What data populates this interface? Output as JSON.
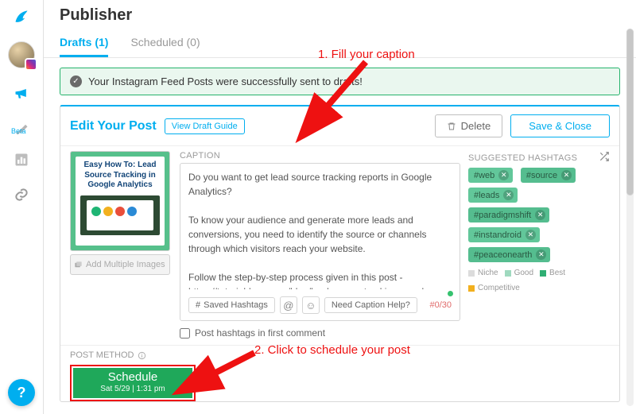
{
  "page": {
    "title": "Publisher"
  },
  "tabs": {
    "drafts": "Drafts (1)",
    "scheduled": "Scheduled (0)"
  },
  "alert": {
    "text": "Your Instagram Feed Posts were successfully sent to drafts!"
  },
  "editor": {
    "title": "Edit Your Post",
    "view_guide": "View Draft Guide",
    "delete": "Delete",
    "save_close": "Save & Close",
    "add_multiple": "Add Multiple Images",
    "thumb_title": "Easy How To: Lead Source Tracking in Google Analytics"
  },
  "caption": {
    "label": "CAPTION",
    "text": "Do you want to get lead source tracking reports in Google Analytics?\n\nTo know your audience and generate more leads and conversions, you need to identify the source or channels through which visitors reach your website.\n\nFollow the step-by-step process given in this post - https://tutorialdeep.com/blog/lead-source-tracking-google-analytics/",
    "saved_hashtags": "Saved Hashtags",
    "need_help": "Need Caption Help?",
    "counter": "#0/30"
  },
  "hashtags": {
    "label": "SUGGESTED HASHTAGS",
    "tags": [
      "#web",
      "#source",
      "#leads",
      "#paradigmshift",
      "#instandroid",
      "#peaceonearth"
    ],
    "legend": {
      "niche": "Niche",
      "good": "Good",
      "best": "Best",
      "comp": "Competitive"
    }
  },
  "options": {
    "first_comment": "Post hashtags in first comment"
  },
  "post_method": {
    "label": "POST METHOD"
  },
  "schedule": {
    "label": "Schedule",
    "sub": "Sat 5/29 | 1:31 pm"
  },
  "annotations": {
    "a1": "1. Fill your caption",
    "a2": "2. Click to schedule your post"
  },
  "help": "?",
  "sidebar_beta": "Beta"
}
